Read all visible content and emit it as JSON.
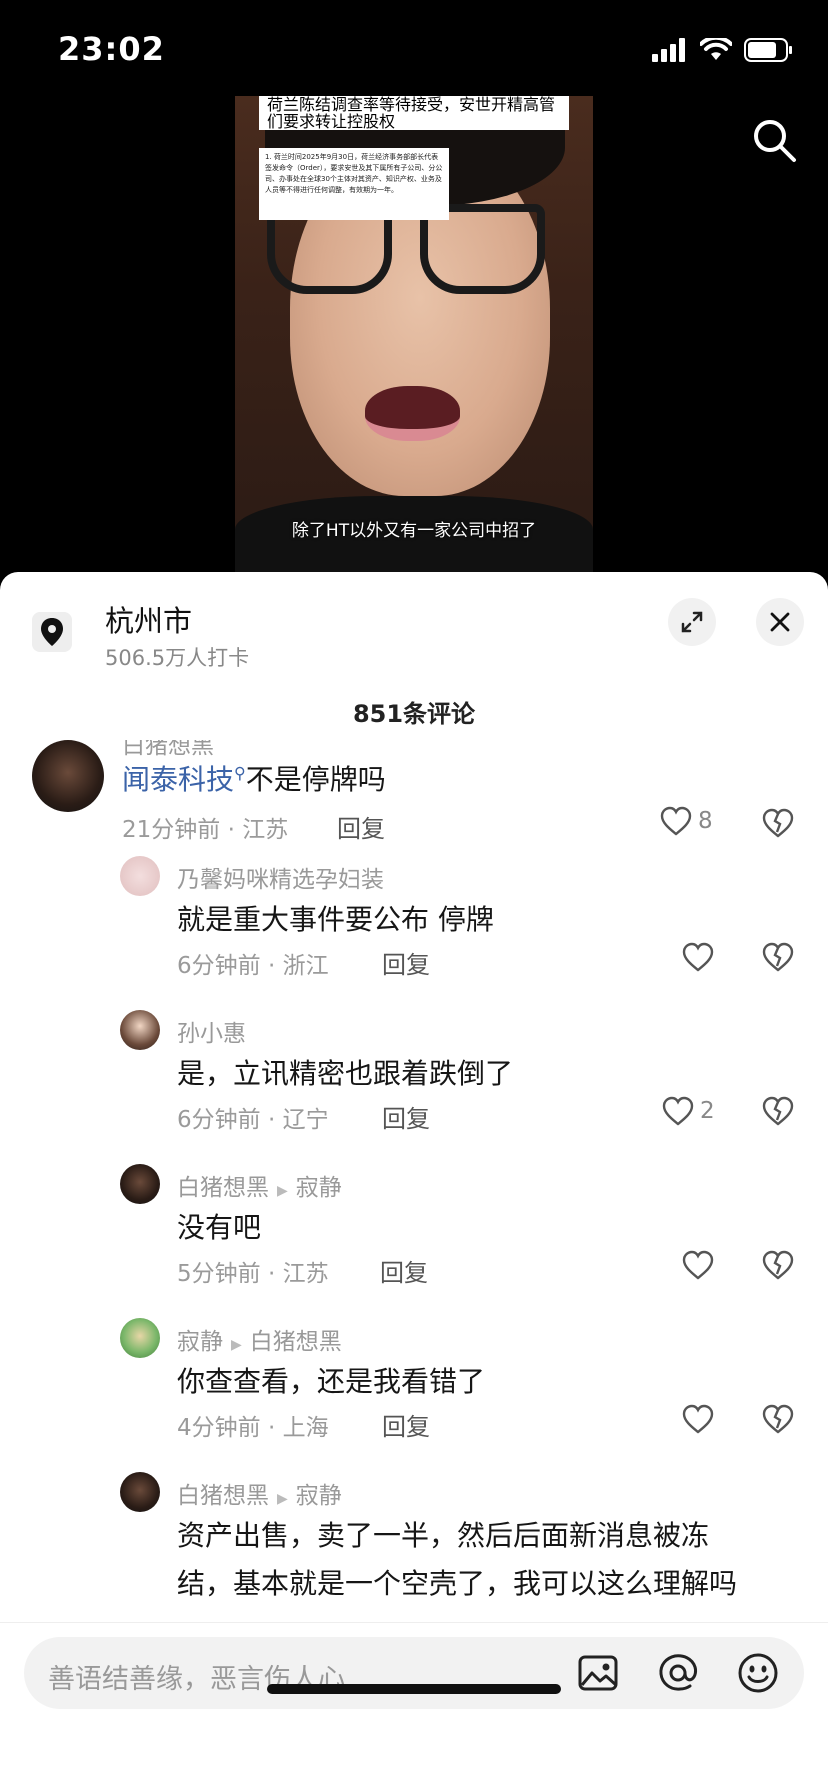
{
  "status": {
    "time": "23:02"
  },
  "video": {
    "headline": "荷兰陈结调查率等待接受，安世开精高管们要求转让控股权",
    "doc_text": "1. 荷兰时间2025年9月30日，荷兰经济事务部部长代表签发命令（Order），要求安世及其下属所有子公司、分公司、办事处在全球30个主体对其资产、知识产权、业务及人员等不得进行任何调整，有效期为一年。",
    "subtitle": "除了HT以外又有一家公司中招了"
  },
  "location": {
    "name": "杭州市",
    "checkins": "506.5万人打卡"
  },
  "comments_header": "851条评论",
  "comments": [
    {
      "author": "白猪想黑",
      "text_highlight": "闻泰科技",
      "text": "不是停牌吗",
      "time": "21分钟前 · 江苏",
      "reply": "回复",
      "likes": "8"
    },
    {
      "author": "乃馨妈咪精选孕妇装",
      "text": "就是重大事件要公布 停牌",
      "time": "6分钟前 · 浙江",
      "reply": "回复",
      "likes": ""
    },
    {
      "author": "孙小惠",
      "text": "是，立讯精密也跟着跌倒了",
      "time": "6分钟前 · 辽宁",
      "reply": "回复",
      "likes": "2"
    },
    {
      "author": "白猪想黑",
      "reply_to": "寂静",
      "text": "没有吧",
      "time": "5分钟前 · 江苏",
      "reply": "回复",
      "likes": ""
    },
    {
      "author": "寂静",
      "reply_to": "白猪想黑",
      "text": "你查查看，还是我看错了",
      "time": "4分钟前 · 上海",
      "reply": "回复",
      "likes": ""
    },
    {
      "author": "白猪想黑",
      "reply_to": "寂静",
      "text": "资产出售，卖了一半，然后后面新消息被冻",
      "text2": "结，基本就是一个空壳了，我可以这么理解吗"
    }
  ],
  "input": {
    "placeholder": "善语结善缘，恶言伤人心"
  },
  "icons": [
    "search-icon",
    "location-pin-icon",
    "expand-icon",
    "close-icon",
    "heart-icon",
    "broken-heart-icon",
    "image-icon",
    "at-icon",
    "emoji-icon"
  ]
}
